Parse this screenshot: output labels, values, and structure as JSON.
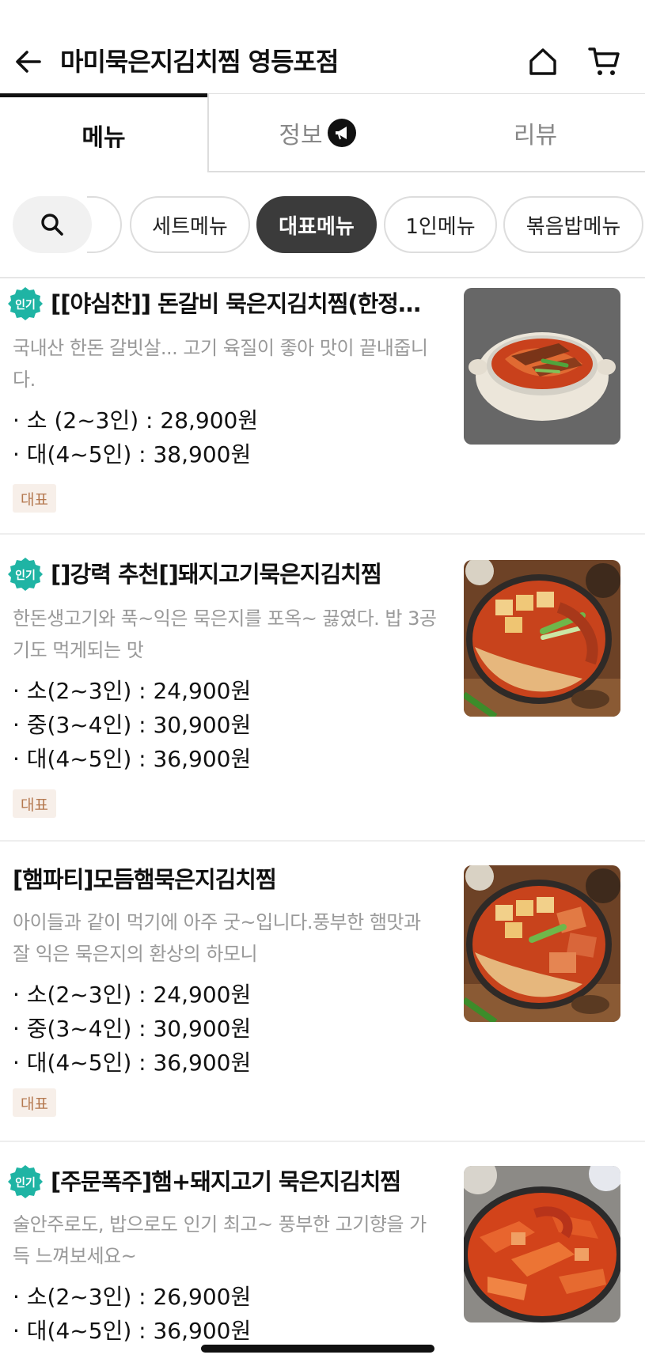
{
  "header": {
    "title": "마미묵은지김치찜 영등포점",
    "back_icon": "arrow-left-icon",
    "home_icon": "home-icon",
    "cart_icon": "cart-icon"
  },
  "tabs": [
    {
      "label": "메뉴",
      "active": true
    },
    {
      "label": "정보",
      "icon": "megaphone-icon"
    },
    {
      "label": "리뷰"
    }
  ],
  "categories": {
    "search_icon": "search-icon",
    "items": [
      {
        "label": "세트메뉴"
      },
      {
        "label": "대표메뉴",
        "active": true
      },
      {
        "label": "1인메뉴"
      },
      {
        "label": "볶음밥메뉴"
      }
    ]
  },
  "popular_badge": "인기",
  "menu_items": [
    {
      "popular": true,
      "name": "[[야심찬]] 돈갈비 묵은지김치찜(한정…",
      "description": "국내산 한돈 갈빗살... 고기 육질이 좋아 맛이 끝내줍니다.",
      "prices": [
        "· 소 (2~3인) : 28,900원",
        "· 대(4~5인) : 38,900원"
      ],
      "tag": "대표"
    },
    {
      "popular": true,
      "name": "[]강력 추천[]돼지고기묵은지김치찜",
      "description": "한돈생고기와 푹~익은 묵은지를 포옥~ 끓였다. 밥 3공기도 먹게되는 맛",
      "prices": [
        "· 소(2~3인) : 24,900원",
        "· 중(3~4인) : 30,900원",
        "· 대(4~5인) : 36,900원"
      ],
      "tag": "대표"
    },
    {
      "popular": false,
      "name": "[햄파티]모듬햄묵은지김치찜",
      "description": "아이들과 같이 먹기에 아주 굿~입니다.풍부한 햄맛과 잘 익은 묵은지의 환상의 하모니",
      "prices": [
        "· 소(2~3인) : 24,900원",
        "· 중(3~4인) : 30,900원",
        "· 대(4~5인) : 36,900원"
      ],
      "tag": "대표"
    },
    {
      "popular": true,
      "name": "[주문폭주]햄+돼지고기 묵은지김치찜",
      "description": "술안주로도, 밥으로도 인기 최고~ 풍부한 고기향을 가득 느껴보세요~",
      "prices": [
        "· 소(2~3인) : 26,900원",
        "· 대(4~5인) : 36,900원"
      ],
      "tag": ""
    }
  ],
  "colors": {
    "accent_badge": "#1fb4a4",
    "tag_bg": "#f7efe9",
    "tag_text": "#b4784f",
    "active_chip": "#3b3b3b"
  }
}
